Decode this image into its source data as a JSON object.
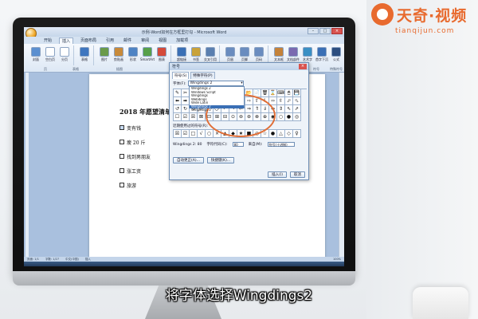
{
  "logo": {
    "name": "天奇·视频",
    "url": "tianqijun.com"
  },
  "subtitle": "将字体选择Wingdings2",
  "word": {
    "window_title": "示例-Word如何在方框里打勾 - Microsoft Word",
    "tabs": [
      "开始",
      "插入",
      "页面布局",
      "引用",
      "邮件",
      "审阅",
      "视图",
      "加载项"
    ],
    "active_tab": "插入",
    "ribbon_icons": [
      {
        "label": "封面",
        "color": "#5b8fd0"
      },
      {
        "label": "空白页",
        "color": "#ffffff"
      },
      {
        "label": "分页",
        "color": "#ffffff"
      },
      {
        "label": "表格",
        "color": "#3f76bf"
      },
      {
        "label": "图片",
        "color": "#6a9a4a"
      },
      {
        "label": "剪贴画",
        "color": "#c88a3a"
      },
      {
        "label": "形状",
        "color": "#4e83c4"
      },
      {
        "label": "SmartArt",
        "color": "#57a04a"
      },
      {
        "label": "图表",
        "color": "#d44a3a"
      },
      {
        "label": "超链接",
        "color": "#3a6fb5"
      },
      {
        "label": "书签",
        "color": "#c9a23a"
      },
      {
        "label": "交叉引用",
        "color": "#5a7fb0"
      },
      {
        "label": "页眉",
        "color": "#6a8cbf"
      },
      {
        "label": "页脚",
        "color": "#6a8cbf"
      },
      {
        "label": "页码",
        "color": "#6a8cbf"
      },
      {
        "label": "文本框",
        "color": "#c4823a"
      },
      {
        "label": "文档部件",
        "color": "#7a6ab0"
      },
      {
        "label": "艺术字",
        "color": "#3a8fc4"
      },
      {
        "label": "首字下沉",
        "color": "#3a6fb5"
      },
      {
        "label": "公式",
        "color": "#2c4e80"
      },
      {
        "label": "符号",
        "color": "#2c4e80"
      },
      {
        "label": "编号",
        "color": "#2c4e80"
      }
    ],
    "group_labels": [
      "页",
      "表格",
      "插图",
      "链接",
      "页眉和页脚",
      "文本",
      "符号",
      "特殊符号"
    ],
    "document": {
      "title": "2018 年愿望清单",
      "items": [
        "变有钱",
        "瘦 20 斤",
        "找到男朋友",
        "涨工资",
        "旅游"
      ]
    },
    "status": [
      "页面: 1/1",
      "字数: 1/27",
      "中文(中国)",
      "插入"
    ],
    "zoom": "100%"
  },
  "symbol_dialog": {
    "title": "符号",
    "tabs": [
      "符号(S)",
      "特殊字符(P)"
    ],
    "font_label": "字体(F):",
    "font_value": "Wingdings 2",
    "font_options": [
      "Wingdings 2",
      "Windows Script",
      "Wingdings",
      "Webdings",
      "Wide Latin",
      "Wingdings 2",
      "Wingdings 3"
    ],
    "highlight_index": 5,
    "symbols": [
      "✎",
      "✂",
      "✁",
      "👁",
      "👂",
      "✉",
      "☎",
      "✆",
      "📁",
      "📂",
      "📄",
      "🗑",
      "⌛",
      "⌨",
      "🖱",
      "💾",
      "⬅",
      "➡",
      "⬆",
      "⬇",
      "⬉",
      "⬈",
      "⬊",
      "⬋",
      "⇦",
      "⇨",
      "⇧",
      "⇩",
      "⬄",
      "⇳",
      "⬀",
      "⬁",
      "↺",
      "↻",
      "⟲",
      "⟳",
      "⤺",
      "⤻",
      "↶",
      "↷",
      "⇐",
      "⇒",
      "⇑",
      "⇓",
      "⇔",
      "⇕",
      "⇖",
      "⇗",
      "☐",
      "☑",
      "☒",
      "⊠",
      "⊡",
      "⊞",
      "⊟",
      "⊙",
      "⊚",
      "⊛",
      "⊗",
      "⊕",
      "◉",
      "○",
      "●",
      "◎"
    ],
    "recent_label": "近期使用过的符号(R):",
    "recent": [
      "☒",
      "☑",
      "□",
      "√",
      "○",
      "×",
      "▲",
      "◆",
      "★",
      "■",
      "◎",
      "☆",
      "●",
      "△",
      "◇",
      "♀"
    ],
    "code_label": "Wingdings 2: 80",
    "char_code_label": "字符代码(C):",
    "char_code": "80",
    "from_label": "来自(M):",
    "from_value": "符号(十进制)",
    "autocorrect_label": "自动更正(A)...",
    "shortcut_label": "快捷键(K)...",
    "insert_label": "插入(I)",
    "cancel_label": "取消"
  }
}
